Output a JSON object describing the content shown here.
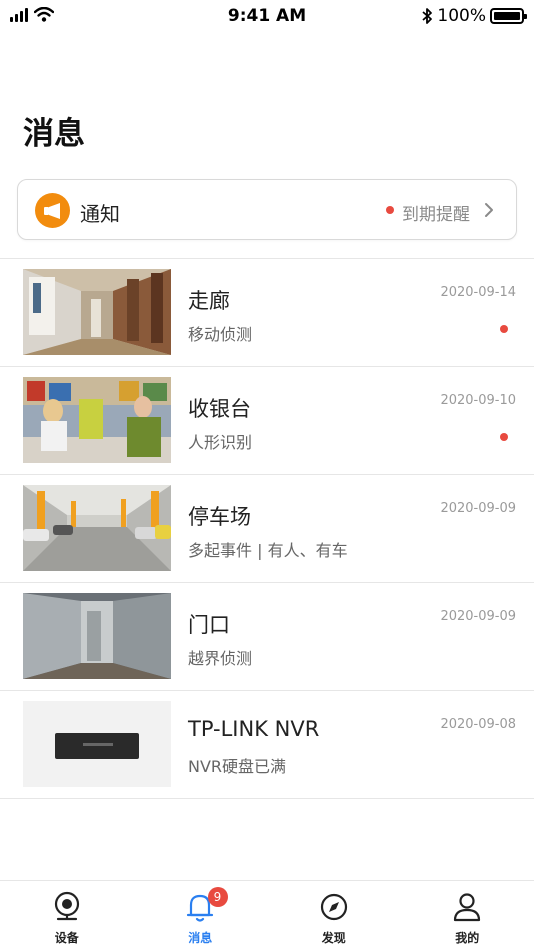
{
  "status_bar": {
    "time": "9:41 AM",
    "battery": "100%"
  },
  "page": {
    "title": "消息"
  },
  "notice": {
    "label": "通知",
    "remind": "到期提醒"
  },
  "messages": [
    {
      "title": "走廊",
      "subtitle": "移动侦测",
      "date": "2020-09-14",
      "unread": true,
      "thumb": "corridor"
    },
    {
      "title": "收银台",
      "subtitle": "人形识别",
      "date": "2020-09-10",
      "unread": true,
      "thumb": "checkout"
    },
    {
      "title": "停车场",
      "subtitle": "多起事件 | 有人、有车",
      "date": "2020-09-09",
      "unread": false,
      "thumb": "parking"
    },
    {
      "title": "门口",
      "subtitle": "越界侦测",
      "date": "2020-09-09",
      "unread": false,
      "thumb": "doorway"
    },
    {
      "title": "TP-LINK NVR",
      "subtitle": "NVR硬盘已满",
      "date": "2020-09-08",
      "unread": false,
      "thumb": "nvr-device"
    }
  ],
  "tabs": [
    {
      "label": "设备",
      "icon": "camera-icon",
      "active": false
    },
    {
      "label": "消息",
      "icon": "bell-icon",
      "active": true,
      "badge": "9"
    },
    {
      "label": "发现",
      "icon": "compass-icon",
      "active": false
    },
    {
      "label": "我的",
      "icon": "user-icon",
      "active": false
    }
  ],
  "colors": {
    "accent": "#2a7ff0",
    "notice_orange": "#f28c0e",
    "unread_dot": "#e84a3f"
  }
}
